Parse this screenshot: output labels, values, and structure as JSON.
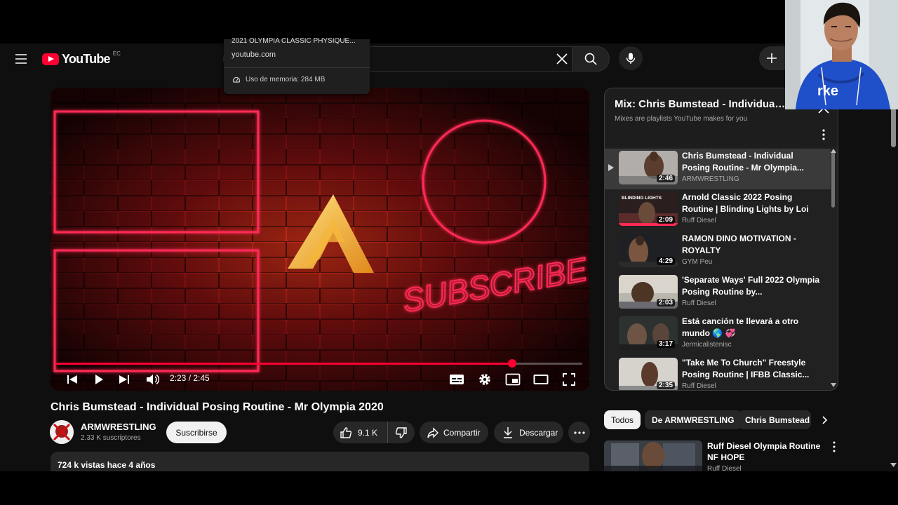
{
  "header": {
    "logo_text": "YouTube",
    "country_code": "EC"
  },
  "tab_tooltip": {
    "title": "2021 OLYMPIA CLASSIC PHYSIQUE...",
    "url": "youtube.com",
    "memory": "Uso de memoria: 284 MB"
  },
  "player": {
    "overlay_text": "SUBSCRIBE",
    "time": "2:23 / 2:45",
    "progress": 0.867
  },
  "video": {
    "title": "Chris Bumstead - Individual Posing Routine - Mr Olympia 2020",
    "channel": "ARMWRESTLING",
    "subscribers": "2.33 K suscriptores",
    "subscribe_label": "Suscribirse",
    "likes": "9.1 K",
    "share_label": "Compartir",
    "download_label": "Descargar",
    "views_and_date": "724 k vistas  hace 4 años"
  },
  "playlist": {
    "title": "Mix: Chris Bumstead - Individual...",
    "subtitle": "Mixes are playlists YouTube makes for you",
    "items": [
      {
        "title": "Chris Bumstead - Individual Posing Routine - Mr Olympia...",
        "channel": "ARMWRESTLING",
        "duration": "2:46"
      },
      {
        "title": "Arnold Classic 2022 Posing Routine | Blinding Lights by Loi",
        "channel": "Ruff Diesel",
        "duration": "2:09",
        "thumb_text": "BLINDING LIGHTS"
      },
      {
        "title": "RAMON DINO MOTIVATION - ROYALTY",
        "channel": "GYM Peu",
        "duration": "4:29"
      },
      {
        "title": "'Separate Ways' Full 2022 Olympia Posing Routine by...",
        "channel": "Ruff Diesel",
        "duration": "2:03"
      },
      {
        "title": "Está canción te llevará a otro mundo 🌎 💞",
        "channel": "Jermicalistenisc",
        "duration": "3:17"
      },
      {
        "title": "\"Take Me To Church\" Freestyle Posing Routine | IFBB Classic...",
        "channel": "Ruff Diesel",
        "duration": "2:35"
      }
    ]
  },
  "chips": [
    "Todos",
    "De ARMWRESTLING",
    "Chris Bumstead"
  ],
  "related": {
    "title": "Ruff Diesel Olympia Routine NF HOPE",
    "channel": "Ruff Diesel"
  },
  "colors": {
    "accent": "#ff0033",
    "background": "#0f0f0f",
    "neon": "#ff2a55"
  }
}
